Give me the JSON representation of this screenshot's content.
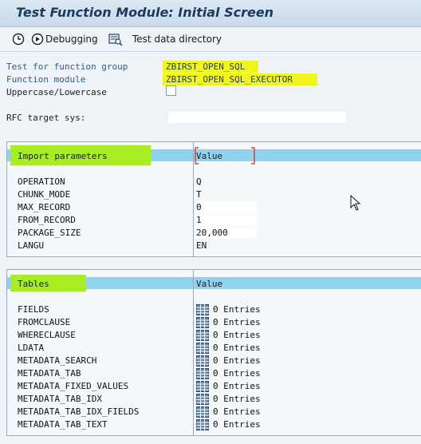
{
  "window": {
    "title": "Test Function Module: Initial Screen"
  },
  "toolbar": {
    "debugging_label": "Debugging",
    "test_data_directory_label": "Test data directory"
  },
  "form": {
    "function_group_label": "Test for function group",
    "function_group_value": "ZBIRST_OPEN_SQL",
    "function_module_label": "Function module",
    "function_module_value": "ZBIRST_OPEN_SQL_EXECUTOR",
    "uppercase_label": "Uppercase/Lowercase",
    "uppercase_checked": false,
    "rfc_label": "RFC target sys:",
    "rfc_value": ""
  },
  "import_params": {
    "header": "Import parameters",
    "value_header": "Value",
    "rows": [
      {
        "name": "OPERATION",
        "value": "Q"
      },
      {
        "name": "CHUNK_MODE",
        "value": "T"
      },
      {
        "name": "MAX_RECORD",
        "value": "0"
      },
      {
        "name": "FROM_RECORD",
        "value": "1"
      },
      {
        "name": "PACKAGE_SIZE",
        "value": "20,000"
      },
      {
        "name": "LANGU",
        "value": "EN"
      }
    ]
  },
  "tables": {
    "header": "Tables",
    "value_header": "Value",
    "rows": [
      {
        "name": "FIELDS",
        "count": "0",
        "unit": "Entries"
      },
      {
        "name": "FROMCLAUSE",
        "count": "0",
        "unit": "Entries"
      },
      {
        "name": "WHERECLAUSE",
        "count": "0",
        "unit": "Entries"
      },
      {
        "name": "LDATA",
        "count": "0",
        "unit": "Entries"
      },
      {
        "name": "METADATA_SEARCH",
        "count": "0",
        "unit": "Entries"
      },
      {
        "name": "METADATA_TAB",
        "count": "0",
        "unit": "Entries"
      },
      {
        "name": "METADATA_FIXED_VALUES",
        "count": "0",
        "unit": "Entries"
      },
      {
        "name": "METADATA_TAB_IDX",
        "count": "0",
        "unit": "Entries"
      },
      {
        "name": "METADATA_TAB_IDX_FIELDS",
        "count": "0",
        "unit": "Entries"
      },
      {
        "name": "METADATA_TAB_TEXT",
        "count": "0",
        "unit": "Entries"
      }
    ]
  },
  "colors": {
    "highlight_yellow": "#f0f51c",
    "header_cyan": "#8fd3ec",
    "highlight_green": "#a8ec24",
    "label_blue": "#2c5d8e"
  },
  "icons": [
    "execute-icon",
    "debug-execute-icon",
    "test-data-directory-icon",
    "table-icon",
    "mouse-cursor-icon"
  ]
}
